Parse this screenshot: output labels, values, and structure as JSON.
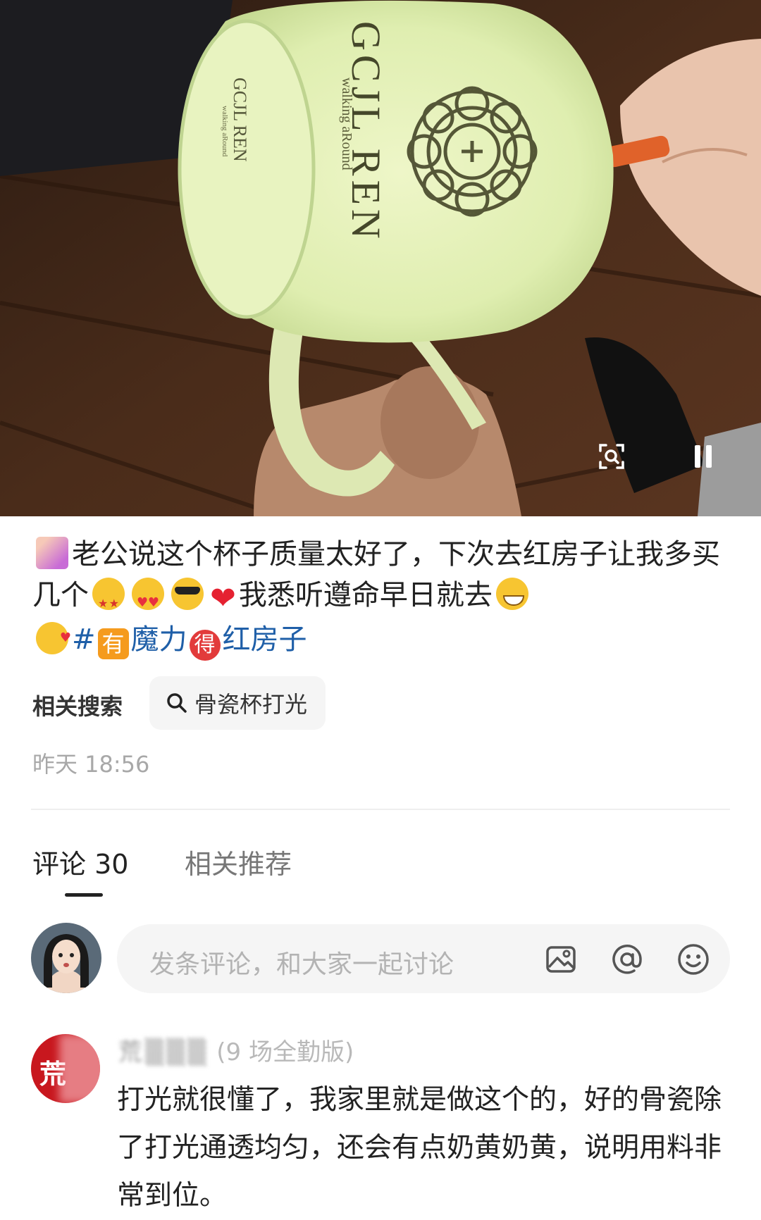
{
  "video": {
    "mug_brand": "GCJL REN",
    "mug_tagline": "walking aRound",
    "mug_bottom_brand": "GCJL REN",
    "mug_bottom_tagline": "walking aRound"
  },
  "post": {
    "caption_part1": "老公说这个杯子质量太好了，下次去红房子让我多买几个",
    "caption_part2": "我悉听遵命早日就去",
    "hashtag_symbol": "#",
    "topic_badge1": "有",
    "topic_text1": "魔力",
    "topic_badge2": "得",
    "topic_text2": "红房子",
    "timestamp": "昨天 18:56"
  },
  "related_search": {
    "label": "相关搜索",
    "query": "骨瓷杯打光"
  },
  "tabs": {
    "comments": "评论 30",
    "recommended": "相关推荐"
  },
  "comment_input": {
    "placeholder": "发条评论，和大家一起讨论"
  },
  "comments": [
    {
      "avatar_text": "荒",
      "user_name_blurred": "荒▒▒▒",
      "user_tag": "(9 场全勤版)",
      "text": "打光就很懂了，我家里就是做这个的，好的骨瓷除了打光通透均匀，还会有点奶黄奶黄，说明用料非常到位。"
    }
  ],
  "colors": {
    "topic_blue": "#1f5fa8",
    "badge_orange": "#f59b1e",
    "badge_red": "#e23b3b",
    "timestamp_gray": "#a8a8a8",
    "mug_lit": "#e4f0b8"
  },
  "icons": [
    "scan-icon",
    "pause-icon",
    "search-icon",
    "image-icon",
    "at-icon",
    "emoji-icon"
  ]
}
